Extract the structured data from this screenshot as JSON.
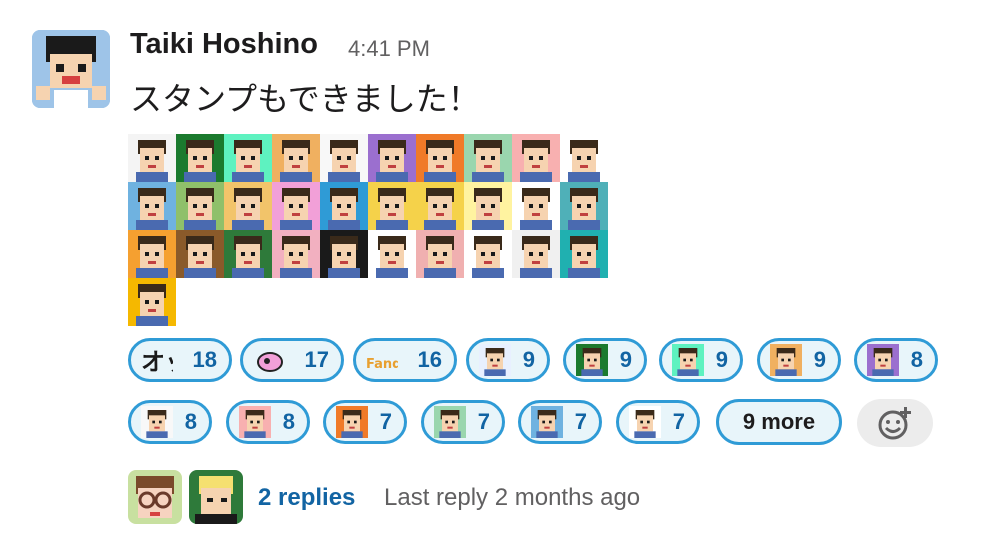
{
  "message": {
    "author": "Taiki Hoshino",
    "time": "4:41 PM",
    "text": "スタンプもできました！"
  },
  "sticker_palette": [
    "#f4f4f4",
    "#1b7a2e",
    "#5ef2c0",
    "#f0b060",
    "#f8f8f8",
    "#9b6fcf",
    "#f07a28",
    "#9ad6ae",
    "#f8b0b0",
    "#ffffff",
    "#6fb2e0",
    "#8fc06a",
    "#f2c46a",
    "#f2a0d8",
    "#2f9bd6",
    "#f5d24a",
    "#f5d24a",
    "#fff3a0",
    "#ffffff",
    "#4fb0b8",
    "#f5a030",
    "#8a5a2a",
    "#2e7a3a",
    "#f2b0c0",
    "#1a1a1a",
    "#ffffff",
    "#f0b0b0",
    "#ffffff",
    "#f0f0f0",
    "#20b0b0",
    "#f5b800"
  ],
  "reactions": [
    {
      "count": "18",
      "icon": "otsu-text-icon"
    },
    {
      "count": "17",
      "icon": "pink-blob-icon"
    },
    {
      "count": "16",
      "icon": "fandom-text-icon"
    },
    {
      "count": "9",
      "icon": "standing-person-icon"
    },
    {
      "count": "9",
      "icon": "green-face-icon"
    },
    {
      "count": "9",
      "icon": "orca-icon"
    },
    {
      "count": "9",
      "icon": "guitar-person-icon"
    },
    {
      "count": "8",
      "icon": "purple-blond-icon"
    },
    {
      "count": "8",
      "icon": "sleeping-face-icon"
    },
    {
      "count": "8",
      "icon": "pink-hair-icon"
    },
    {
      "count": "7",
      "icon": "orange-face-icon"
    },
    {
      "count": "7",
      "icon": "computer-person-icon"
    },
    {
      "count": "7",
      "icon": "blue-hair-icon"
    },
    {
      "count": "7",
      "icon": "glasses-sketch-icon"
    }
  ],
  "more_label": "9 more",
  "thread": {
    "replies": "2 replies",
    "last_reply": "Last reply 2 months ago"
  }
}
